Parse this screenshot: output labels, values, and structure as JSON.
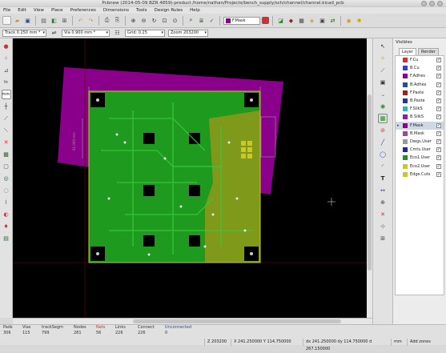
{
  "window": {
    "title": "Pcbnew (2014-05-09 BZR 4859)-product /home/nathan/Projects/bench_supply/sch/channel/channel.kicad_pcb"
  },
  "menu": [
    "File",
    "Edit",
    "View",
    "Place",
    "Preferences",
    "Dimensions",
    "Tools",
    "Design Rules",
    "Help"
  ],
  "toolbar": {
    "active_layer": "F.Mask",
    "active_layer_color": "#8b008b"
  },
  "toolbar2": {
    "track": "Track 0.250 mm *",
    "via": "Via 0.900 mm *",
    "grid": "Grid: 0.25",
    "zoom": "Zoom 203200"
  },
  "canvas": {
    "dimension_text": "61.000 mm"
  },
  "visibles": {
    "title": "Visibles",
    "tabs": [
      "Layer",
      "Render"
    ],
    "layers": [
      {
        "name": "F.Cu",
        "color": "#c83434"
      },
      {
        "name": "B.Cu",
        "color": "#3a3ae0"
      },
      {
        "name": "F.Adhes",
        "color": "#8b008b"
      },
      {
        "name": "B.Adhes",
        "color": "#1c4fa0"
      },
      {
        "name": "F.Paste",
        "color": "#a02020"
      },
      {
        "name": "B.Paste",
        "color": "#1a3a9a"
      },
      {
        "name": "F.SilkS",
        "color": "#2ab8b8"
      },
      {
        "name": "B.SilkS",
        "color": "#9a1a9a"
      },
      {
        "name": "F.Mask",
        "color": "#8b008b"
      },
      {
        "name": "B.Mask",
        "color": "#9a4a9a"
      },
      {
        "name": "Dwgs.User",
        "color": "#9a9a9a"
      },
      {
        "name": "Cmts.User",
        "color": "#1a2a9a"
      },
      {
        "name": "Eco1.User",
        "color": "#2a8a2a"
      },
      {
        "name": "Eco2.User",
        "color": "#c8c82a"
      },
      {
        "name": "Edge.Cuts",
        "color": "#c8c82a"
      }
    ],
    "selected_layer": "F.Mask"
  },
  "status": {
    "headers": [
      "Pads",
      "Vias",
      "trackSegm",
      "Nodes",
      "Nets",
      "Links",
      "Connect",
      "Unconnected"
    ],
    "values": [
      "306",
      "115",
      "799",
      "281",
      "56",
      "226",
      "226",
      "0"
    ],
    "zoom": "Z 203200",
    "xy": "X 241.250000  Y 114.750000",
    "dxdy": "dx 241.250000  dy 114.750000  d 267.150000",
    "units": "mm",
    "mode": "Add zones"
  }
}
